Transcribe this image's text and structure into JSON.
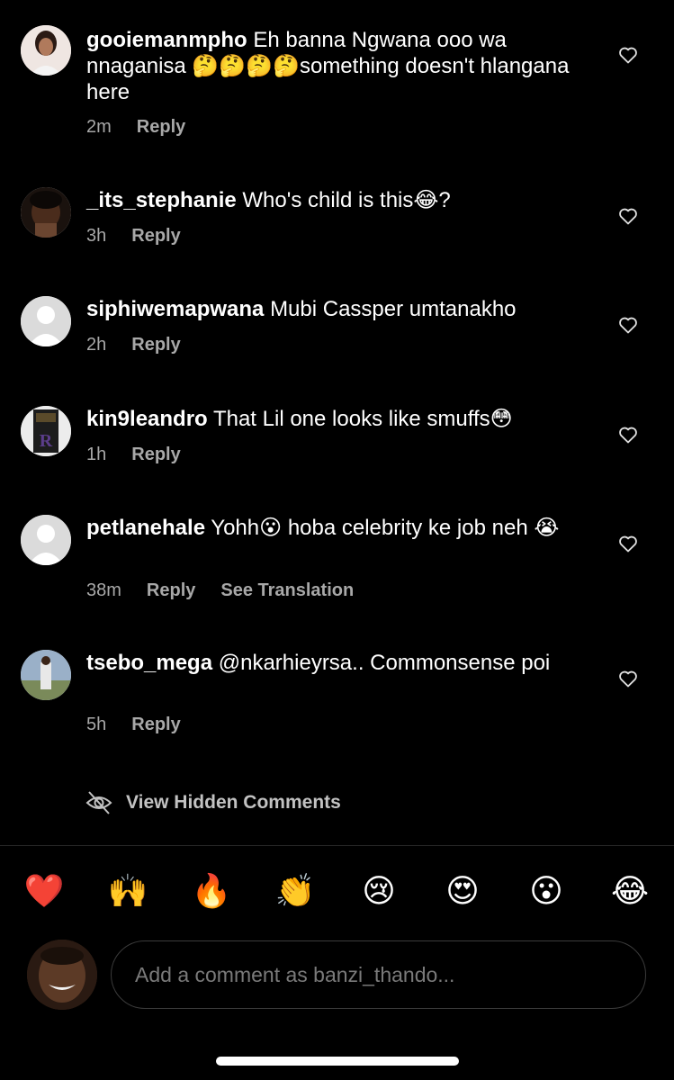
{
  "comments": [
    {
      "username": "gooiemanmpho",
      "text": "Eh banna Ngwana ooo wa nnaganisa 🤔🤔🤔🤔something doesn't hlangana here",
      "time": "2m",
      "reply_label": "Reply"
    },
    {
      "username": "_its_stephanie",
      "text": "Who's child is this😂?",
      "time": "3h",
      "reply_label": "Reply"
    },
    {
      "username": "siphiwemapwana",
      "text": "Mubi Cassper umtanakho",
      "time": "2h",
      "reply_label": "Reply"
    },
    {
      "username": "kin9leandro",
      "text": "That Lil one  looks like smuffs😳",
      "time": "1h",
      "reply_label": "Reply"
    },
    {
      "username": "petlanehale",
      "text": "Yohh😮  hoba celebrity ke job neh 😭",
      "time": "38m",
      "reply_label": "Reply",
      "translate_label": "See Translation"
    },
    {
      "username": "tsebo_mega",
      "text": "@nkarhieyrsa.. Commonsense poi",
      "time": "5h",
      "reply_label": "Reply"
    }
  ],
  "hidden_comments_label": "View Hidden Comments",
  "emoji_bar": [
    "❤️",
    "🙌",
    "🔥",
    "👏",
    "😢",
    "😍",
    "😮",
    "😂"
  ],
  "composer": {
    "placeholder": "Add a comment as banzi_thando..."
  },
  "colors": {
    "background": "#000000",
    "secondary_text": "#a8a8a8",
    "divider": "#262626"
  }
}
